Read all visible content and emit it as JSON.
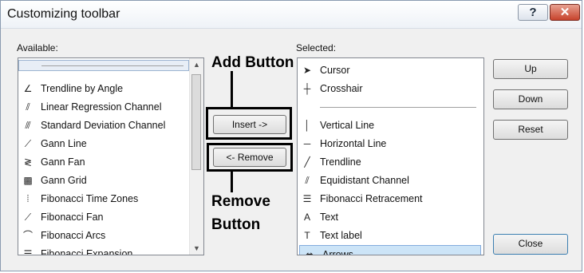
{
  "window": {
    "title": "Customizing toolbar",
    "help_glyph": "?",
    "close_glyph": "✕"
  },
  "available": {
    "label": "Available:",
    "items": [
      {
        "label": "",
        "icon": "separator-icon"
      },
      {
        "label": "Trendline by Angle",
        "icon": "trendline-angle-icon",
        "glyph": "∠"
      },
      {
        "label": "Linear Regression Channel",
        "icon": "regression-channel-icon",
        "glyph": "⫽"
      },
      {
        "label": "Standard Deviation Channel",
        "icon": "stddev-channel-icon",
        "glyph": "⫻"
      },
      {
        "label": "Gann Line",
        "icon": "gann-line-icon",
        "glyph": "⟋"
      },
      {
        "label": "Gann Fan",
        "icon": "gann-fan-icon",
        "glyph": "≷"
      },
      {
        "label": "Gann Grid",
        "icon": "gann-grid-icon",
        "glyph": "▩"
      },
      {
        "label": "Fibonacci Time Zones",
        "icon": "fibo-time-zones-icon",
        "glyph": "⦙"
      },
      {
        "label": "Fibonacci Fan",
        "icon": "fibo-fan-icon",
        "glyph": "⟋"
      },
      {
        "label": "Fibonacci Arcs",
        "icon": "fibo-arcs-icon",
        "glyph": "⌒"
      },
      {
        "label": "Fibonacci Expansion",
        "icon": "fibo-expansion-icon",
        "glyph": "☰"
      }
    ]
  },
  "selected": {
    "label": "Selected:",
    "items": [
      {
        "label": "Cursor",
        "icon": "cursor-icon",
        "glyph": "➤"
      },
      {
        "label": "Crosshair",
        "icon": "crosshair-icon",
        "glyph": "┼"
      },
      {
        "label": "",
        "icon": "separator-icon"
      },
      {
        "label": "Vertical Line",
        "icon": "vertical-line-icon",
        "glyph": "│"
      },
      {
        "label": "Horizontal Line",
        "icon": "horizontal-line-icon",
        "glyph": "─"
      },
      {
        "label": "Trendline",
        "icon": "trendline-icon",
        "glyph": "╱"
      },
      {
        "label": "Equidistant Channel",
        "icon": "equidistant-channel-icon",
        "glyph": "⫽"
      },
      {
        "label": "Fibonacci Retracement",
        "icon": "fibo-retracement-icon",
        "glyph": "☰"
      },
      {
        "label": "Text",
        "icon": "text-icon",
        "glyph": "A"
      },
      {
        "label": "Text label",
        "icon": "text-label-icon",
        "glyph": "T"
      },
      {
        "label": "Arrows",
        "icon": "arrows-icon",
        "glyph": "⬌",
        "selected": true
      }
    ]
  },
  "buttons": {
    "insert": "Insert ->",
    "remove": "<- Remove",
    "up": "Up",
    "down": "Down",
    "reset": "Reset",
    "close": "Close"
  },
  "annotations": {
    "add_button": "Add Button",
    "remove_line1": "Remove",
    "remove_line2": "Button"
  }
}
